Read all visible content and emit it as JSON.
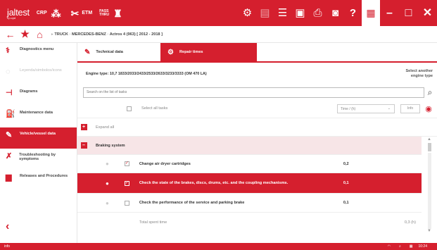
{
  "topbar": {
    "logo": "jaltest",
    "logo_sub": "by cojali",
    "items": [
      {
        "label": "CRP",
        "icon": "network-icon"
      },
      {
        "label": "ETM",
        "icon": "tools-icon"
      },
      {
        "label": "PASS THRU",
        "icon": "connector-icon"
      }
    ]
  },
  "breadcrumb": {
    "segments": [
      "TRUCK",
      "MERCEDES-BENZ",
      "Actros 4 (963) [ 2012 - 2018 ]"
    ]
  },
  "sidebar": {
    "items": [
      {
        "label": "Diagnostics menu",
        "state": "normal"
      },
      {
        "label": "Leyenda/simbolos/icons",
        "state": "disabled"
      },
      {
        "label": "Diagrams",
        "state": "normal"
      },
      {
        "label": "Maintenance data",
        "state": "normal"
      },
      {
        "label": "Vehicle/vessel data",
        "state": "active"
      },
      {
        "label": "Troubleshooting by symptoms",
        "state": "normal"
      },
      {
        "label": "Releases and Procedures",
        "state": "normal"
      }
    ]
  },
  "tabs": [
    {
      "label": "Technical data",
      "active": false
    },
    {
      "label": "Repair times",
      "active": true
    }
  ],
  "engine": {
    "label": "Engine type:",
    "value": "10,7 1833/2033/2433/2533/2633/3233/3333 (OM 470 LA)",
    "select_another": "Select another engine type"
  },
  "search": {
    "placeholder": "Search on the list of tasks"
  },
  "list": {
    "select_all": "Select all tasks",
    "time_unit": "Time / (h)",
    "info": "Info",
    "expand_all": "Expand all",
    "group": "Braking system",
    "tasks": [
      {
        "label": "Change air dryer cartridges",
        "time": "0,2",
        "checked": true,
        "selected": false
      },
      {
        "label": "Check the state of the brakes, discs, drums, etc. and the coupling mechanisms.",
        "time": "0,1",
        "checked": true,
        "selected": true
      },
      {
        "label": "Check the performance of the service and parking brake",
        "time": "0,1",
        "checked": false,
        "selected": false
      }
    ],
    "total_label": "Total spent time",
    "total_value": "0,3 (h)"
  },
  "footer": {
    "left": "info",
    "time": "10:24"
  }
}
